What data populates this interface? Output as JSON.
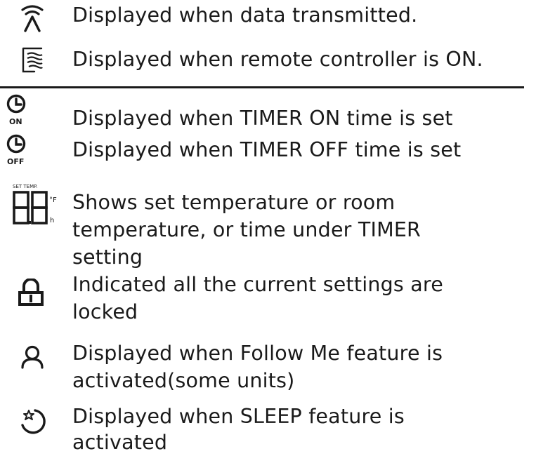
{
  "legend": [
    {
      "icon": "transmission-icon",
      "text": "Displayed when data transmitted."
    },
    {
      "icon": "remote-on-icon",
      "text": "Displayed when remote controller is ON."
    },
    {
      "icon": "timer-on-icon",
      "icon_label": "ON",
      "text": "Displayed when TIMER ON time is set"
    },
    {
      "icon": "timer-off-icon",
      "icon_label": "OFF",
      "text": "Displayed when TIMER OFF time is set"
    },
    {
      "icon": "temperature-display-icon",
      "icon_labels": {
        "top": "SET TEMP.",
        "unit_f": "°F",
        "unit_h": "h"
      },
      "text_lines": [
        "Shows set temperature or room",
        "temperature, or time under TIMER",
        "setting"
      ]
    },
    {
      "icon": "lock-icon",
      "text_lines": [
        "Indicated all the current settings are",
        "locked"
      ]
    },
    {
      "icon": "follow-me-icon",
      "text_lines": [
        "Displayed when Follow Me feature is",
        "activated(some units)"
      ]
    },
    {
      "icon": "sleep-icon",
      "text_lines": [
        "Displayed when SLEEP feature is",
        "activated"
      ]
    }
  ]
}
